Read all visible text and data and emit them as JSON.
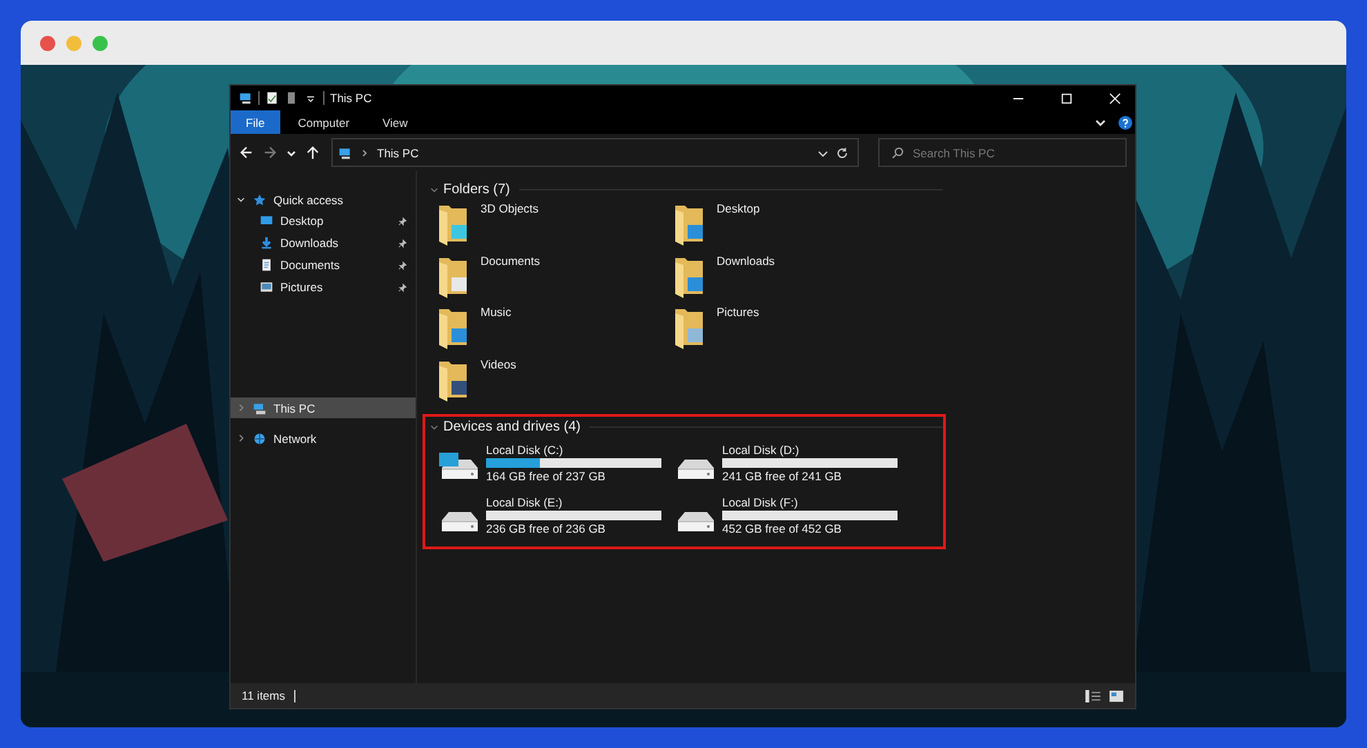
{
  "browser": {
    "buttons": [
      {
        "color": "#e8514b"
      },
      {
        "color": "#f2bd3a"
      },
      {
        "color": "#38c24a"
      }
    ]
  },
  "explorer": {
    "title": "This PC",
    "ribbon_tabs": [
      {
        "label": "File",
        "selected": true
      },
      {
        "label": "Computer",
        "selected": false
      },
      {
        "label": "View",
        "selected": false
      }
    ],
    "address": "This PC",
    "search": {
      "placeholder": "Search This PC"
    },
    "navigation": [
      {
        "label": "Quick access",
        "expanded": true,
        "selected": false,
        "children": [
          {
            "label": "Desktop",
            "pinned": true
          },
          {
            "label": "Downloads",
            "pinned": true
          },
          {
            "label": "Documents",
            "pinned": true
          },
          {
            "label": "Pictures",
            "pinned": true
          }
        ]
      },
      {
        "label": "This PC",
        "expanded": false,
        "selected": true
      },
      {
        "label": "Network",
        "expanded": false,
        "selected": false
      }
    ],
    "folders": {
      "title": "Folders (7)",
      "expanded": true,
      "items": [
        "3D Objects",
        "Desktop",
        "Documents",
        "Downloads",
        "Music",
        "Pictures",
        "Videos"
      ]
    },
    "drives": {
      "title": "Devices and drives (4)",
      "expanded": true,
      "highlighted": true,
      "items": [
        {
          "name": "Local Disk (C:)",
          "system": true,
          "level": 0.31,
          "reading": "164 GB free of 237 GB"
        },
        {
          "name": "Local Disk (D:)",
          "system": false,
          "level": 0,
          "reading": "241 GB free of 241 GB"
        },
        {
          "name": "Local Disk (E:)",
          "system": false,
          "level": 0,
          "reading": "236 GB free of 236 GB"
        },
        {
          "name": "Local Disk (F:)",
          "system": false,
          "level": 0,
          "reading": "452 GB free of 452 GB"
        }
      ]
    },
    "status_bar": {
      "items": "11 items"
    }
  }
}
